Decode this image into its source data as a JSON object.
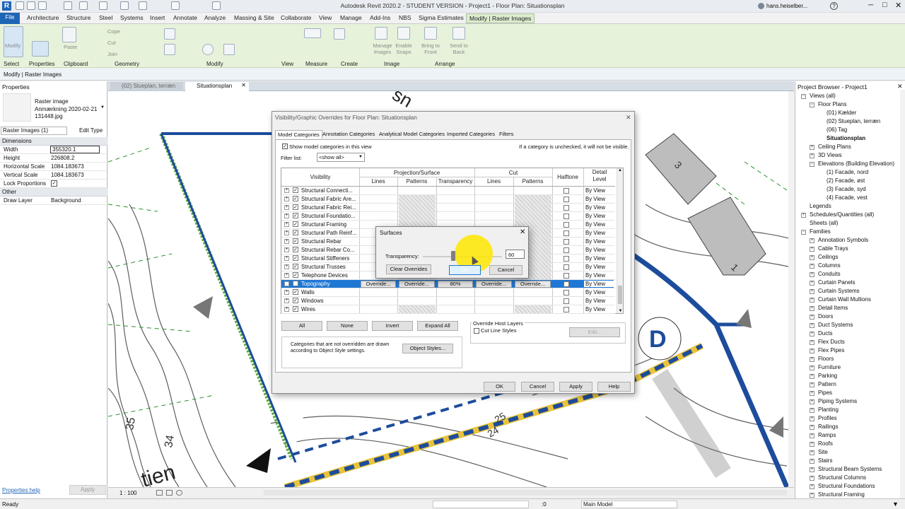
{
  "app": {
    "title": "Autodesk Revit 2020.2 - STUDENT VERSION - Project1 - Floor Plan: Situationsplan",
    "user": "hans.heiselber..."
  },
  "menu": [
    "File",
    "Architecture",
    "Structure",
    "Steel",
    "Systems",
    "Insert",
    "Annotate",
    "Analyze",
    "Massing & Site",
    "Collaborate",
    "View",
    "Manage",
    "Add-Ins",
    "NBS",
    "Sigma Estimates",
    "Modify | Raster Images"
  ],
  "ribbon": {
    "panels": [
      "Select",
      "Properties",
      "Clipboard",
      "Geometry",
      "Modify",
      "View",
      "Measure",
      "Create",
      "Image",
      "Arrange"
    ],
    "modify_label": "Modify",
    "paste_label": "Paste",
    "cope_label": "Cope",
    "cut_label": "Cut",
    "join_label": "Join",
    "manage_images": "Manage Images",
    "enable_snaps": "Enable Snaps",
    "bring_to_front": "Bring to Front",
    "send_to_back": "Send to Back"
  },
  "context_label": "Modify | Raster Images",
  "properties": {
    "title": "Properties",
    "type_name": "Raster image",
    "type_value": "Anmærkning 2020-02-21 131448.jpg",
    "selector": "Raster Images (1)",
    "edit_type": "Edit Type",
    "dimensions_header": "Dimensions",
    "rows": [
      {
        "k": "Width",
        "v": "355320.1"
      },
      {
        "k": "Height",
        "v": "226808.2"
      },
      {
        "k": "Horizontal Scale",
        "v": "1084.183673"
      },
      {
        "k": "Vertical Scale",
        "v": "1084.183673"
      },
      {
        "k": "Lock Proportions",
        "v": "✓"
      }
    ],
    "other_header": "Other",
    "draw_layer_k": "Draw Layer",
    "draw_layer_v": "Background",
    "help_link": "Properties help",
    "apply": "Apply"
  },
  "view_tabs": [
    {
      "label": "(02) Stueplan, terræn"
    },
    {
      "label": "Situationsplan"
    }
  ],
  "canvas": {
    "map_label_d": "D",
    "labels": [
      "35",
      "34",
      "25",
      "24",
      "3",
      "1",
      "tien",
      "sn"
    ]
  },
  "view_scale": "1 : 100",
  "vg": {
    "title": "Visibility/Graphic Overrides for Floor Plan: Situationsplan",
    "tabs": [
      "Model Categories",
      "Annotation Categories",
      "Analytical Model Categories",
      "Imported Categories",
      "Filters"
    ],
    "show_model": "Show model categories in this view",
    "hint": "If a category is unchecked, it will not be visible.",
    "filter_label": "Filter list:",
    "filter_value": "<show all>",
    "headers": {
      "visibility": "Visibility",
      "proj": "Projection/Surface",
      "cut": "Cut",
      "lines": "Lines",
      "patterns": "Patterns",
      "transparency": "Transparency",
      "cut_lines": "Lines",
      "cut_patterns": "Patterns",
      "halftone": "Halftone",
      "detail": "Detail Level"
    },
    "rows": [
      {
        "name": "Structural Connecti...",
        "detail": "By View"
      },
      {
        "name": "Structural Fabric Are...",
        "detail": "By View"
      },
      {
        "name": "Structural Fabric Rei...",
        "detail": "By View"
      },
      {
        "name": "Structural Foundatio...",
        "detail": "By View"
      },
      {
        "name": "Structural Framing",
        "detail": "By View"
      },
      {
        "name": "Structural Path Reinf...",
        "detail": "By View"
      },
      {
        "name": "Structural Rebar",
        "detail": "By View"
      },
      {
        "name": "Structural Rebar Co...",
        "detail": "By View"
      },
      {
        "name": "Structural Stiffeners",
        "detail": "By View"
      },
      {
        "name": "Structural Trusses",
        "detail": "By View"
      },
      {
        "name": "Telephone Devices",
        "detail": "By View"
      },
      {
        "name": "Topography",
        "detail": "By View"
      },
      {
        "name": "Walls",
        "detail": "By View"
      },
      {
        "name": "Windows",
        "detail": "By View"
      },
      {
        "name": "Wires",
        "detail": "By View"
      }
    ],
    "selected_cells": {
      "lines": "Override...",
      "patterns": "Override...",
      "transparency": "80%",
      "cut_lines": "Override...",
      "cut_patterns": "Override..."
    },
    "buttons": {
      "all": "All",
      "none": "None",
      "invert": "Invert",
      "expand_all": "Expand All",
      "object_styles": "Object Styles...",
      "edit": "Edit...",
      "ok": "OK",
      "cancel": "Cancel",
      "apply": "Apply",
      "help": "Help"
    },
    "host_layers": "Override Host Layers",
    "cut_line_styles": "Cut Line Styles",
    "note": "Categories that are not overridden are drawn according to Object Style settings."
  },
  "surfaces": {
    "title": "Surfaces",
    "transparency_label": "Transparency:",
    "transparency_value": "60",
    "transparency_level_pct": 60,
    "clear": "Clear Overrides",
    "ok": "OK",
    "cancel": "Cancel"
  },
  "browser": {
    "title": "Project Browser - Project1",
    "items": [
      {
        "label": "Views (all)",
        "lvl": 0,
        "box": "−"
      },
      {
        "label": "Floor Plans",
        "lvl": 1,
        "box": "−"
      },
      {
        "label": "(01) Kælder",
        "lvl": 2
      },
      {
        "label": "(02) Stueplan, terræn",
        "lvl": 2
      },
      {
        "label": "(06) Tag",
        "lvl": 2
      },
      {
        "label": "Situationsplan",
        "lvl": 2,
        "bold": true
      },
      {
        "label": "Ceiling Plans",
        "lvl": 1,
        "box": "+"
      },
      {
        "label": "3D Views",
        "lvl": 1,
        "box": "+"
      },
      {
        "label": "Elevations (Building Elevation)",
        "lvl": 1,
        "box": "−"
      },
      {
        "label": "(1) Facade, nord",
        "lvl": 2
      },
      {
        "label": "(2) Facade, øst",
        "lvl": 2
      },
      {
        "label": "(3) Facade, syd",
        "lvl": 2
      },
      {
        "label": "(4) Facade, vest",
        "lvl": 2
      },
      {
        "label": "Legends",
        "lvl": 0,
        "box": ""
      },
      {
        "label": "Schedules/Quantities (all)",
        "lvl": 0,
        "box": "+"
      },
      {
        "label": "Sheets (all)",
        "lvl": 0,
        "box": ""
      },
      {
        "label": "Families",
        "lvl": 0,
        "box": "−"
      },
      {
        "label": "Annotation Symbols",
        "lvl": 1,
        "box": "+"
      },
      {
        "label": "Cable Trays",
        "lvl": 1,
        "box": "+"
      },
      {
        "label": "Ceilings",
        "lvl": 1,
        "box": "+"
      },
      {
        "label": "Columns",
        "lvl": 1,
        "box": "+"
      },
      {
        "label": "Conduits",
        "lvl": 1,
        "box": "+"
      },
      {
        "label": "Curtain Panels",
        "lvl": 1,
        "box": "+"
      },
      {
        "label": "Curtain Systems",
        "lvl": 1,
        "box": "+"
      },
      {
        "label": "Curtain Wall Mullions",
        "lvl": 1,
        "box": "+"
      },
      {
        "label": "Detail Items",
        "lvl": 1,
        "box": "+"
      },
      {
        "label": "Doors",
        "lvl": 1,
        "box": "+"
      },
      {
        "label": "Duct Systems",
        "lvl": 1,
        "box": "+"
      },
      {
        "label": "Ducts",
        "lvl": 1,
        "box": "+"
      },
      {
        "label": "Flex Ducts",
        "lvl": 1,
        "box": "+"
      },
      {
        "label": "Flex Pipes",
        "lvl": 1,
        "box": "+"
      },
      {
        "label": "Floors",
        "lvl": 1,
        "box": "+"
      },
      {
        "label": "Furniture",
        "lvl": 1,
        "box": "+"
      },
      {
        "label": "Parking",
        "lvl": 1,
        "box": "+"
      },
      {
        "label": "Pattern",
        "lvl": 1,
        "box": "+"
      },
      {
        "label": "Pipes",
        "lvl": 1,
        "box": "+"
      },
      {
        "label": "Piping Systems",
        "lvl": 1,
        "box": "+"
      },
      {
        "label": "Planting",
        "lvl": 1,
        "box": "+"
      },
      {
        "label": "Profiles",
        "lvl": 1,
        "box": "+"
      },
      {
        "label": "Railings",
        "lvl": 1,
        "box": "+"
      },
      {
        "label": "Ramps",
        "lvl": 1,
        "box": "+"
      },
      {
        "label": "Roofs",
        "lvl": 1,
        "box": "+"
      },
      {
        "label": "Site",
        "lvl": 1,
        "box": "+"
      },
      {
        "label": "Stairs",
        "lvl": 1,
        "box": "+"
      },
      {
        "label": "Structural Beam Systems",
        "lvl": 1,
        "box": "+"
      },
      {
        "label": "Structural Columns",
        "lvl": 1,
        "box": "+"
      },
      {
        "label": "Structural Foundations",
        "lvl": 1,
        "box": "+"
      },
      {
        "label": "Structural Framing",
        "lvl": 1,
        "box": "+"
      }
    ]
  },
  "status": {
    "text": "Ready",
    "coord": ":0",
    "model": "Main Model"
  },
  "colors": {
    "accent": "#1f65b6",
    "ribbon": "#e6f2da",
    "selected_row": "#1f77d4",
    "highlight": "#ffe600"
  }
}
